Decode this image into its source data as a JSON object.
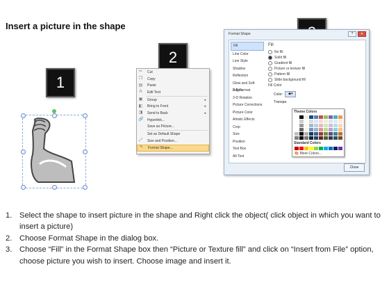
{
  "title": "Insert a picture in the shape",
  "badges": {
    "one": "1",
    "two": "2",
    "three": "3"
  },
  "context_menu": {
    "items": [
      {
        "label": "Cut"
      },
      {
        "label": "Copy"
      },
      {
        "label": "Paste"
      },
      {
        "label": "Edit Text"
      },
      {
        "label": "Group"
      },
      {
        "label": "Bring to Front"
      },
      {
        "label": "Send to Back"
      },
      {
        "label": "Hyperlink..."
      },
      {
        "label": "Save as Picture..."
      },
      {
        "label": "Set as Default Shape"
      },
      {
        "label": "Size and Position..."
      },
      {
        "label": "Format Shape..."
      }
    ]
  },
  "dialog": {
    "title": "Format Shape",
    "categories": [
      "Fill",
      "Line Color",
      "Line Style",
      "Shadow",
      "Reflection",
      "Glow and Soft Edges",
      "3-D Format",
      "3-D Rotation",
      "Picture Corrections",
      "Picture Color",
      "Artistic Effects",
      "Crop",
      "Size",
      "Position",
      "Text Box",
      "Alt Text"
    ],
    "pane_heading": "Fill",
    "fill_options": [
      "No fill",
      "Solid fill",
      "Gradient fill",
      "Picture or texture fill",
      "Pattern fill",
      "Slide background fill"
    ],
    "fill_color_label": "Fill Color",
    "color_label": "Color:",
    "transparency_label": "Transpa",
    "theme_colors_label": "Theme Colors",
    "standard_colors_label": "Standard Colors",
    "more_colors_label": "More Colors...",
    "close_label": "Close",
    "theme_colors": [
      "#ffffff",
      "#000000",
      "#eeece1",
      "#1f497d",
      "#4f81bd",
      "#c0504d",
      "#9bbb59",
      "#8064a2",
      "#4bacc6",
      "#f79646"
    ],
    "standard_colors": [
      "#c00000",
      "#ff0000",
      "#ffc000",
      "#ffff00",
      "#92d050",
      "#00b050",
      "#00b0f0",
      "#0070c0",
      "#002060",
      "#7030a0"
    ]
  },
  "instructions": [
    {
      "num": "1.",
      "text": "Select the shape to insert picture in the shape and Right click the object( click object in which you want to insert a picture)"
    },
    {
      "num": "2.",
      "text": "Choose Format Shape in the dialog box."
    },
    {
      "num": "3.",
      "text": "Choose “Fill” in the Format Shape box then “Picture or Texture fill” and click on “Insert from File” option, choose picture you wish to insert. Choose image and insert it."
    }
  ]
}
